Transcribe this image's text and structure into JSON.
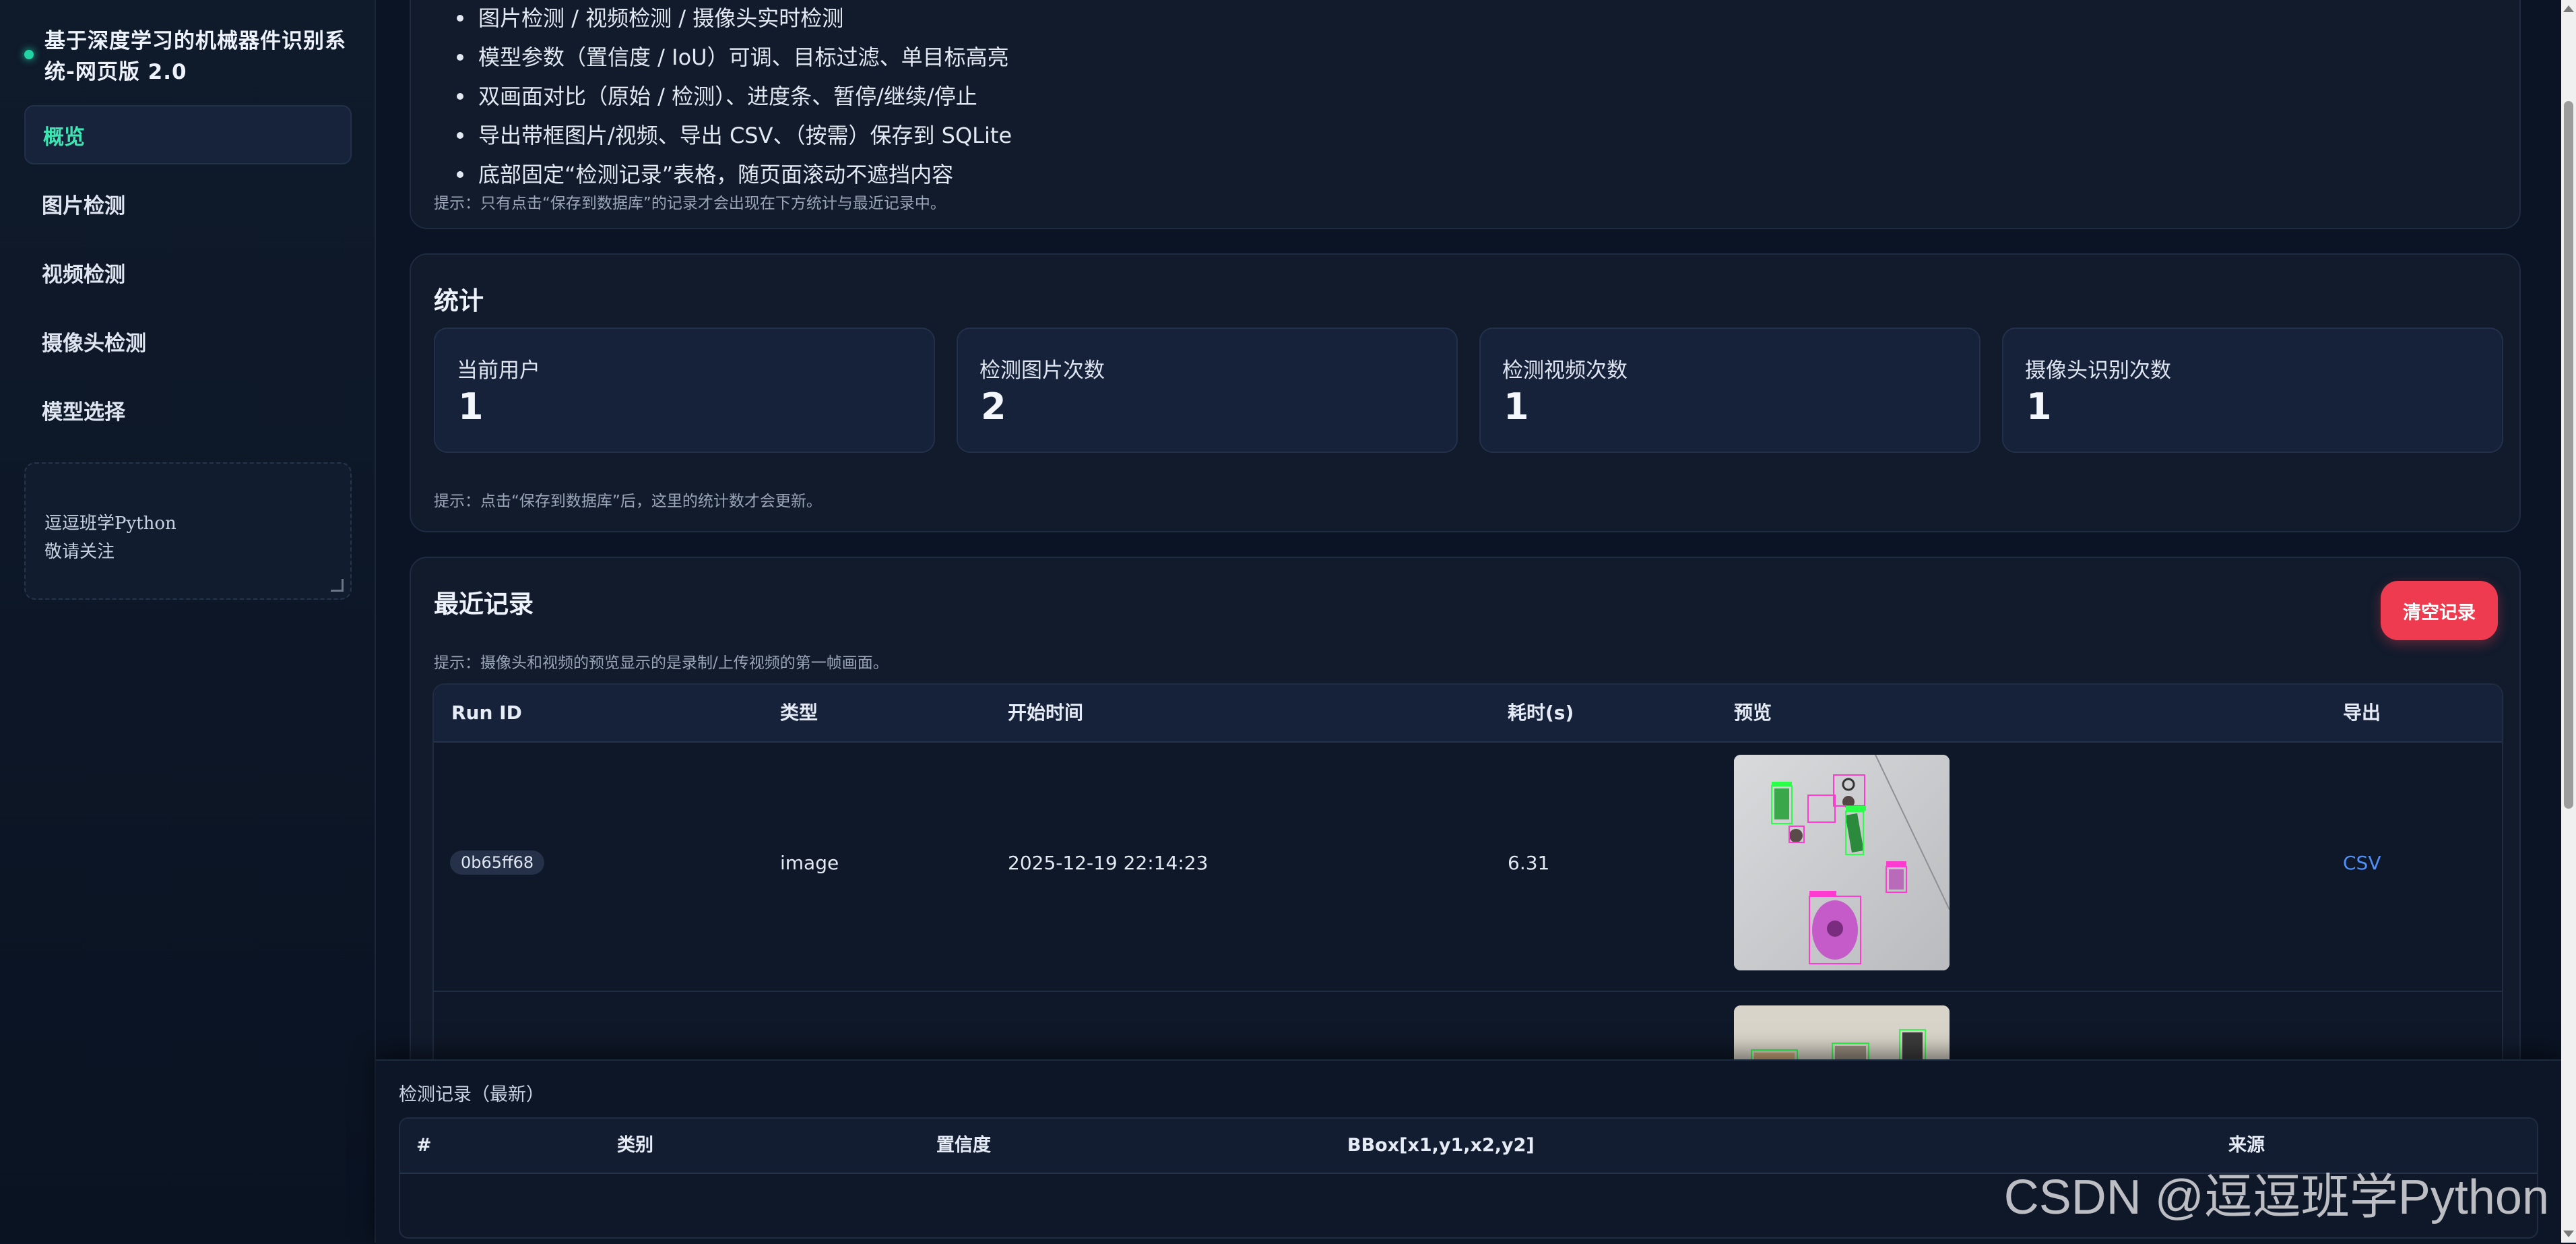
{
  "app": {
    "title": "基于深度学习的机械器件识别系统-网页版 2.0"
  },
  "sidebar": {
    "items": [
      {
        "label": "概览",
        "active": true
      },
      {
        "label": "图片检测",
        "active": false
      },
      {
        "label": "视频检测",
        "active": false
      },
      {
        "label": "摄像头检测",
        "active": false
      },
      {
        "label": "模型选择",
        "active": false
      }
    ],
    "note": "逗逗班学Python\n敬请关注"
  },
  "features": {
    "items": [
      "图片检测 / 视频检测 / 摄像头实时检测",
      "模型参数（置信度 / IoU）可调、目标过滤、单目标高亮",
      "双画面对比（原始 / 检测）、进度条、暂停/继续/停止",
      "导出带框图片/视频、导出 CSV、（按需）保存到 SQLite",
      "底部固定“检测记录”表格，随页面滚动不遮挡内容"
    ],
    "hint": "提示：只有点击“保存到数据库”的记录才会出现在下方统计与最近记录中。"
  },
  "stats": {
    "title": "统计",
    "cards": [
      {
        "label": "当前用户",
        "value": "1"
      },
      {
        "label": "检测图片次数",
        "value": "2"
      },
      {
        "label": "检测视频次数",
        "value": "1"
      },
      {
        "label": "摄像头识别次数",
        "value": "1"
      }
    ],
    "hint": "提示：点击“保存到数据库”后，这里的统计数才会更新。"
  },
  "recent": {
    "title": "最近记录",
    "clear_label": "清空记录",
    "hint": "提示：摄像头和视频的预览显示的是录制/上传视频的第一帧画面。",
    "columns": [
      "Run ID",
      "类型",
      "开始时间",
      "耗时(s)",
      "预览",
      "导出"
    ],
    "rows": [
      {
        "run_id": "0b65ff68",
        "type": "image",
        "start_time": "2025-12-19 22:14:23",
        "duration": "6.31",
        "export": "CSV"
      }
    ]
  },
  "log": {
    "title": "检测记录（最新）",
    "columns": [
      "#",
      "类别",
      "置信度",
      "BBox[x1,y1,x2,y2]",
      "来源"
    ]
  },
  "watermark": "CSDN @逗逗班学Python",
  "colors": {
    "accent": "#3ee4b2",
    "danger": "#ee3b4f",
    "link": "#4f8ff7",
    "background": "#0b1424"
  }
}
